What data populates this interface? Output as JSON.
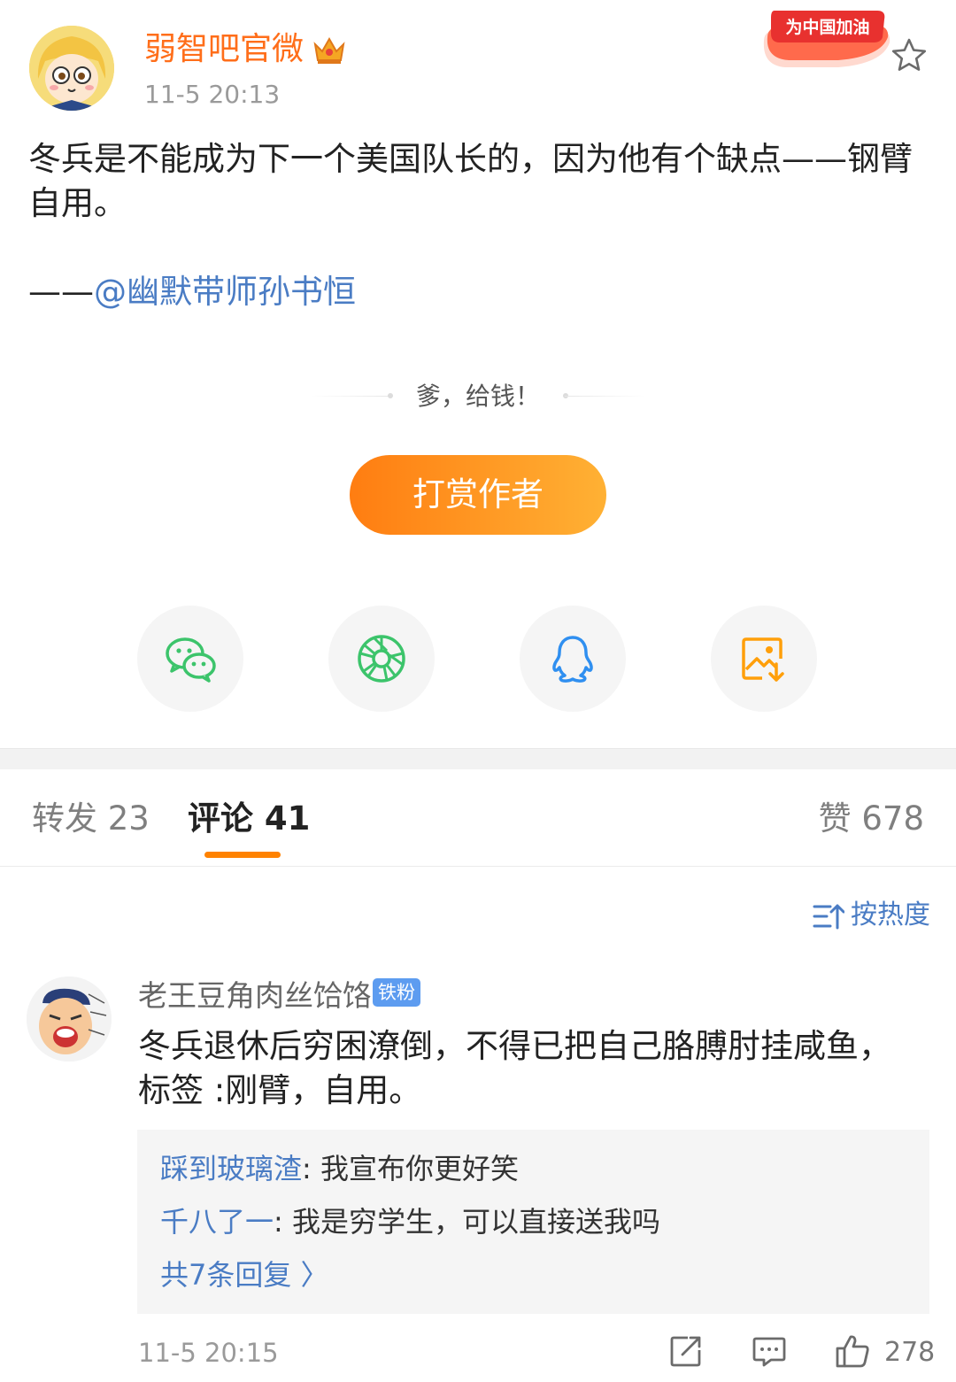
{
  "post": {
    "author": "弱智吧官微",
    "time": "11-5 20:13",
    "badge_text": "为中国加油",
    "content": "冬兵是不能成为下一个美国队长的，因为他有个缺点——钢臂自用。",
    "credit_prefix": "——",
    "credit_mention": "@幽默带师孙书恒"
  },
  "reward": {
    "prompt": "爹，给钱！",
    "button": "打赏作者"
  },
  "share": {
    "items": [
      {
        "icon": "wechat-icon"
      },
      {
        "icon": "moments-icon"
      },
      {
        "icon": "qq-icon"
      },
      {
        "icon": "save-image-icon"
      }
    ]
  },
  "tabs": {
    "repost": "转发 23",
    "comments": "评论 41",
    "likes": "赞 678"
  },
  "sort": {
    "label": "按热度"
  },
  "comment": {
    "user": "老王豆角肉丝饸饹",
    "fan_badge": "铁粉",
    "text": "冬兵退休后穷困潦倒，不得已把自己胳膊肘挂咸鱼，标签 :刚臂，自用。",
    "replies": [
      {
        "user": "踩到玻璃渣",
        "sep": ": ",
        "text": "我宣布你更好笑"
      },
      {
        "user": "千八了一",
        "sep": ": ",
        "text": "我是穷学生，可以直接送我吗"
      }
    ],
    "more_replies": "共7条回复 〉",
    "time": "11-5 20:15",
    "like_count": "278"
  },
  "colors": {
    "accent_orange": "#ff8200",
    "author_orange": "#ff6e1a",
    "link_blue": "#4a7cc4",
    "wechat_green": "#3cc46b",
    "qq_blue": "#2f8ff0",
    "save_orange": "#ff9f0a"
  }
}
